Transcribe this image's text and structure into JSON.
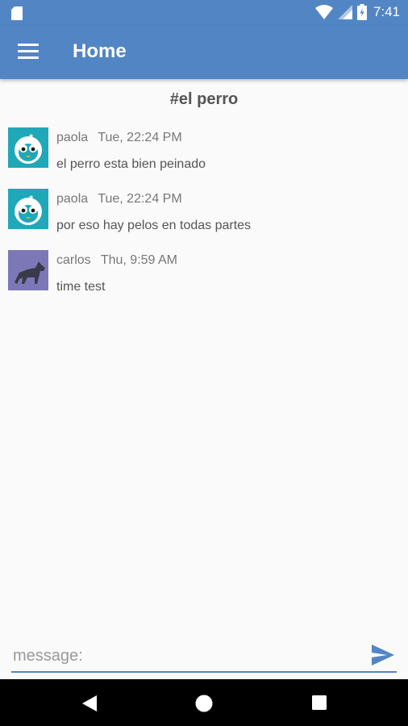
{
  "status_bar": {
    "time": "7:41"
  },
  "app_bar": {
    "title": "Home"
  },
  "channel": {
    "title": "#el perro"
  },
  "messages": [
    {
      "user": "paola",
      "time": "Tue, 22:24 PM",
      "text": "el perro esta bien peinado",
      "avatar": "penguin-avatar"
    },
    {
      "user": "paola",
      "time": "Tue, 22:24 PM",
      "text": "por eso hay pelos en todas partes",
      "avatar": "penguin-avatar"
    },
    {
      "user": "carlos",
      "time": "Thu, 9:59 AM",
      "text": "time test",
      "avatar": "wolf-avatar"
    }
  ],
  "composer": {
    "placeholder": "message:"
  },
  "colors": {
    "primary": "#5285c4",
    "penguin_bg": "#1fa8b8",
    "wolf_bg": "#7c78b8"
  },
  "icons": [
    "sd-card-icon",
    "wifi-icon",
    "signal-icon",
    "battery-icon",
    "menu-icon",
    "send-icon",
    "back-icon",
    "home-icon",
    "recents-icon"
  ]
}
